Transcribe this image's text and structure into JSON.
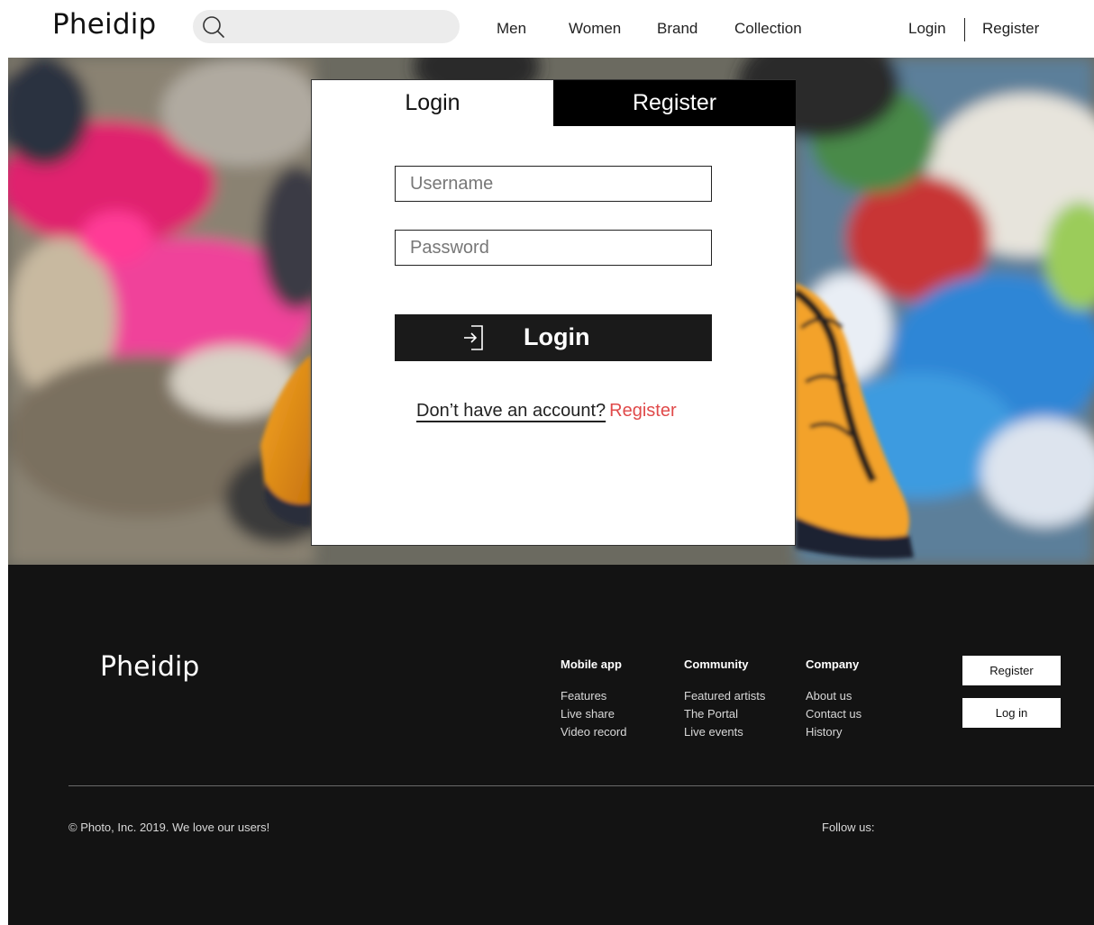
{
  "header": {
    "logo": "Pheidip",
    "search": {
      "placeholder": "",
      "value": ""
    },
    "nav": [
      "Men",
      "Women",
      "Brand",
      "Collection"
    ],
    "login": "Login",
    "register": "Register"
  },
  "card": {
    "tabs": {
      "login": "Login",
      "register": "Register"
    },
    "active_tab": "Login",
    "username_placeholder": "Username",
    "password_placeholder": "Password",
    "login_button": "Login",
    "no_account": "Don’t have an account?",
    "register_link": "Register"
  },
  "footer": {
    "logo": "Pheidip",
    "columns": [
      {
        "heading": "Mobile app",
        "items": [
          "Features",
          "Live share",
          "Video record"
        ]
      },
      {
        "heading": "Community",
        "items": [
          "Featured artists",
          "The Portal",
          "Live events"
        ]
      },
      {
        "heading": "Company",
        "items": [
          "About us",
          "Contact us",
          "History"
        ]
      }
    ],
    "register_button": "Register",
    "login_button": "Log in",
    "copyright": "© Photo, Inc. 2019. We love our users!",
    "follow": "Follow us:"
  },
  "colors": {
    "accent_link": "#e04a4a",
    "footer_bg": "#131313",
    "button_dark": "#1a1a1a",
    "search_bg": "#ececec"
  },
  "icons": [
    "search-icon",
    "login-arrow-icon"
  ]
}
